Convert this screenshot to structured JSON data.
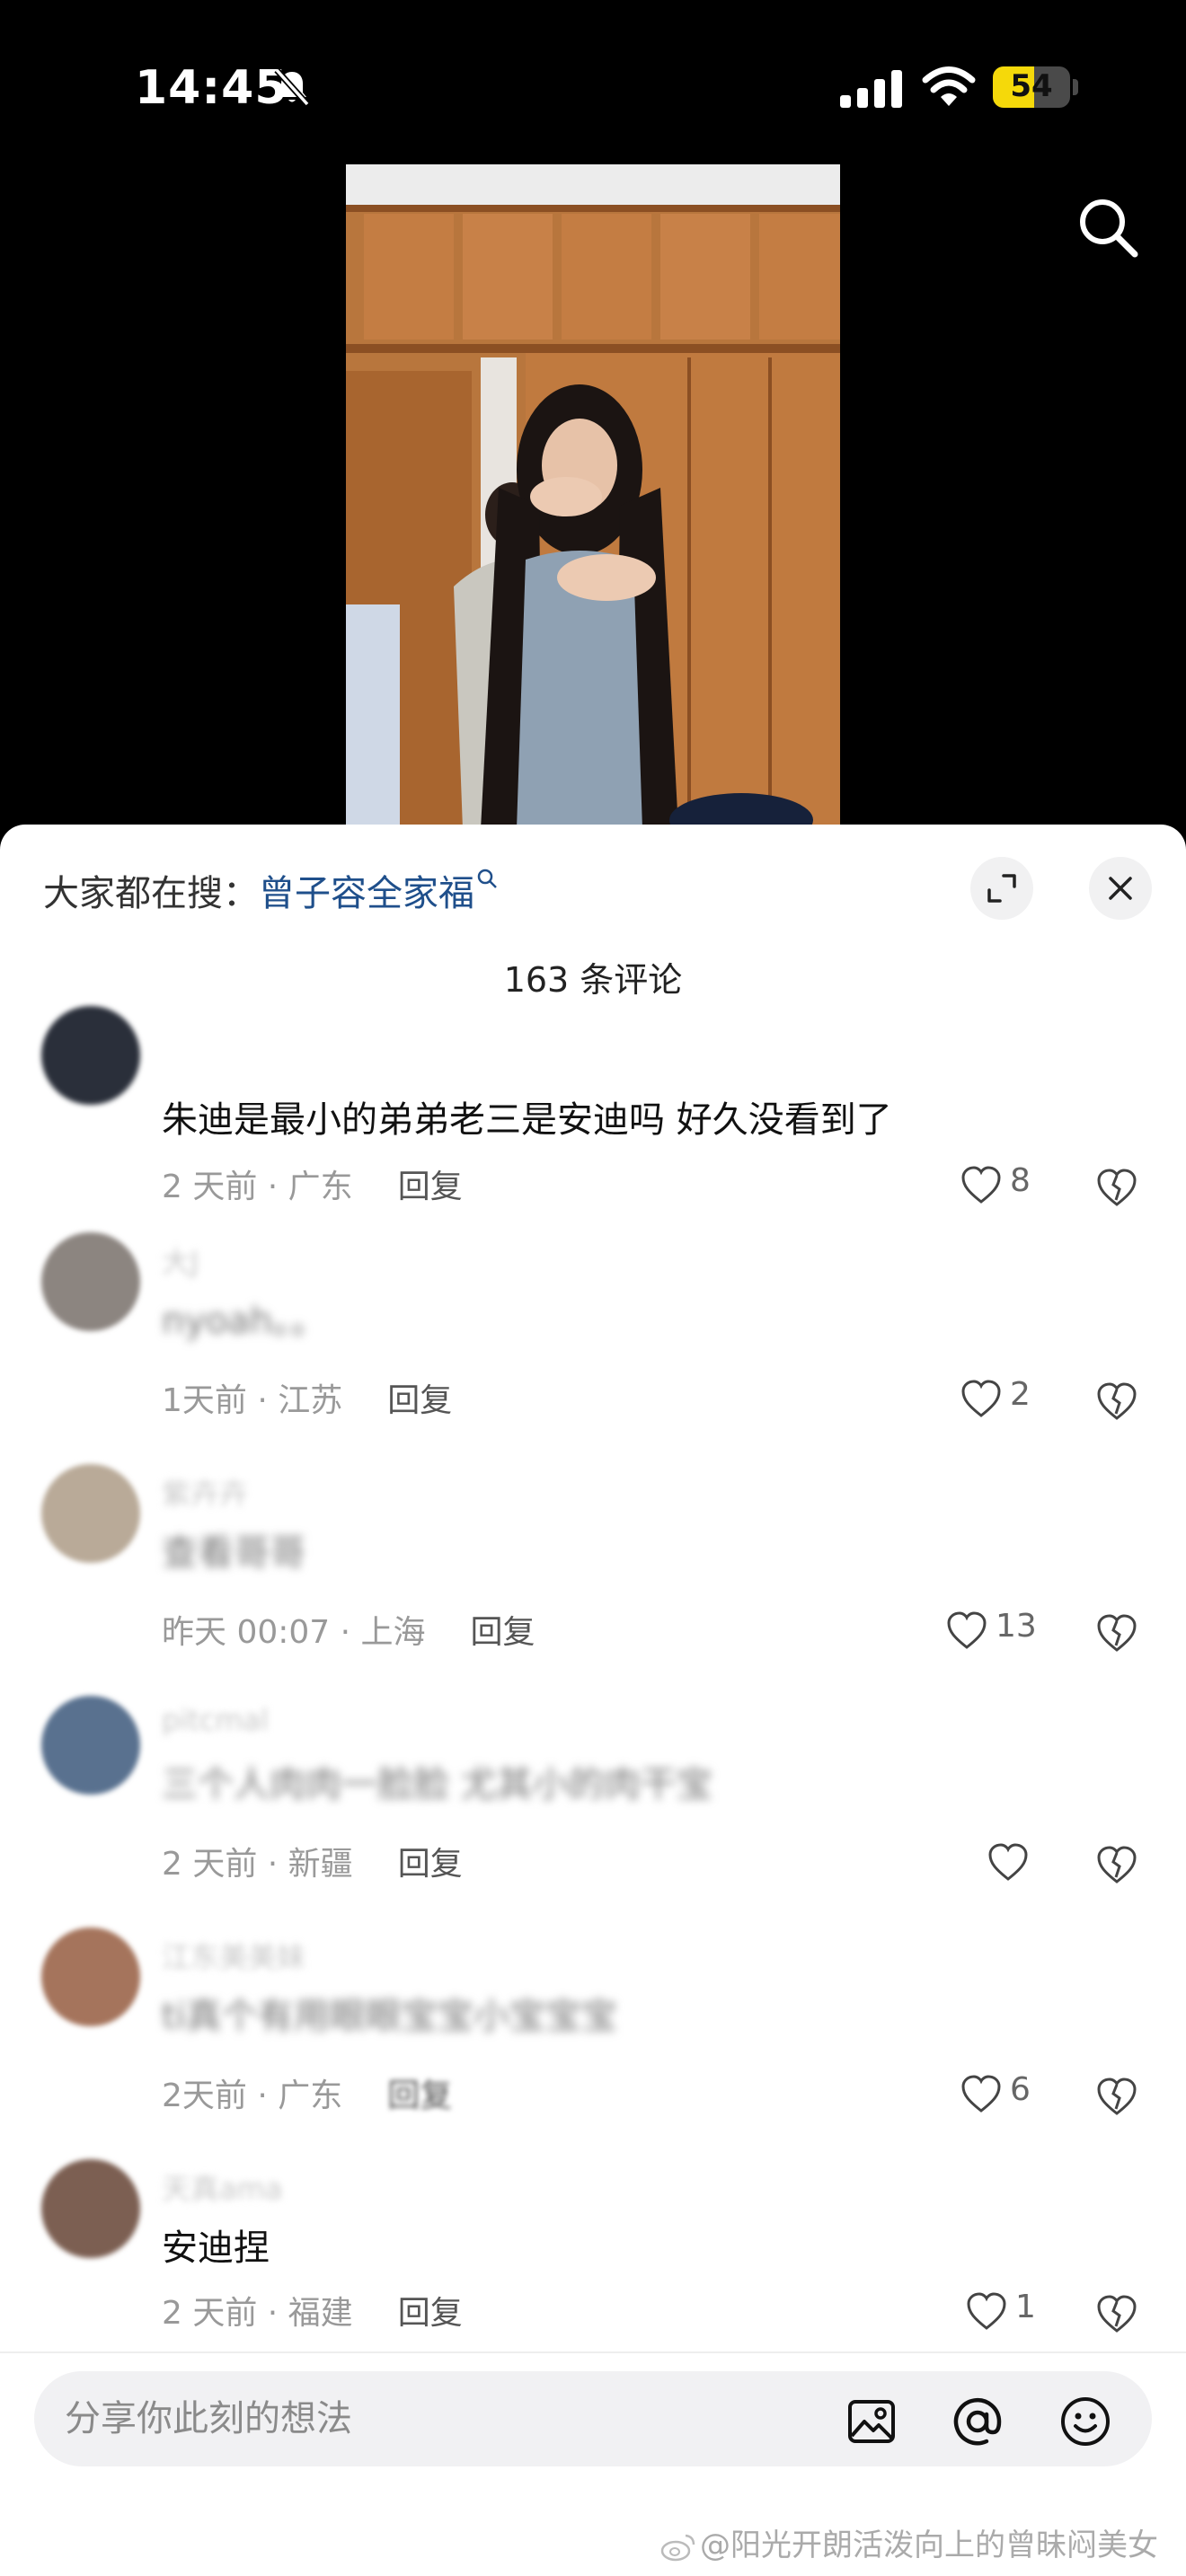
{
  "status_bar": {
    "time": "14:45",
    "battery": "54",
    "battery_level": 0.54
  },
  "search_bar": {
    "prefix": "大家都在搜：",
    "keyword": "曾子容全家福"
  },
  "comments_header": {
    "count_text": "163 条评论"
  },
  "comments": [
    {
      "text": "朱迪是最小的弟弟老三是安迪吗 好久没看到了",
      "meta": "2 天前 · 广东",
      "reply": "回复",
      "likes": "8"
    },
    {
      "name": "大J",
      "text": "nyoah。。",
      "meta": "1天前 · 江苏",
      "reply": "回复",
      "likes": "2"
    },
    {
      "name": "紫卉卉",
      "text": "查看哥哥",
      "meta": "昨天 00:07 · 上海",
      "reply": "回复",
      "likes": "13"
    },
    {
      "name": "pitcmal",
      "text": "三个人肉肉一脸脸 尤其小的肉干宝",
      "meta": "2 天前 · 新疆",
      "reply": "回复",
      "likes": ""
    },
    {
      "name": "江东美美妹",
      "text": "ti真个有用眼眼宝宝小宝宝宝",
      "meta": "2天前 · 广东",
      "reply": "回复",
      "likes": "6"
    },
    {
      "name": "天真ama",
      "text": "安迪捏",
      "meta": "2 天前 · 福建",
      "reply": "回复",
      "likes": "1"
    }
  ],
  "input": {
    "placeholder": "分享你此刻的想法"
  },
  "watermark": "@阳光开朗活泼向上的曾昧闷美女",
  "colors": {
    "accent_link": "#1f4f8b",
    "battery": "#f5d90a"
  }
}
